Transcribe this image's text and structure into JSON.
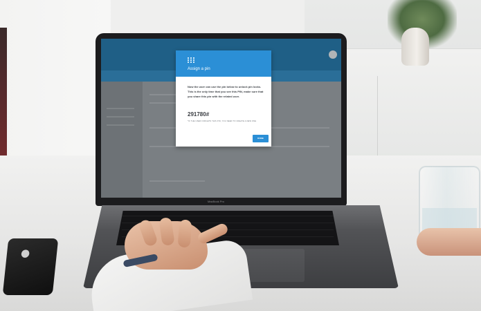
{
  "laptop": {
    "brand_text": "MacBook Pro"
  },
  "dialog": {
    "title": "Assign a pin",
    "body": "Now the user can use the pin below to unlock pin locks. This is the only time that you see this PIN, make sure that you share this pin with the related user.",
    "pin": "291780#",
    "note": "*If the user forgets this pin, you need to create a new one",
    "done_label": "DONE",
    "icon": "grid-icon",
    "accent_color": "#2b8fd6"
  }
}
